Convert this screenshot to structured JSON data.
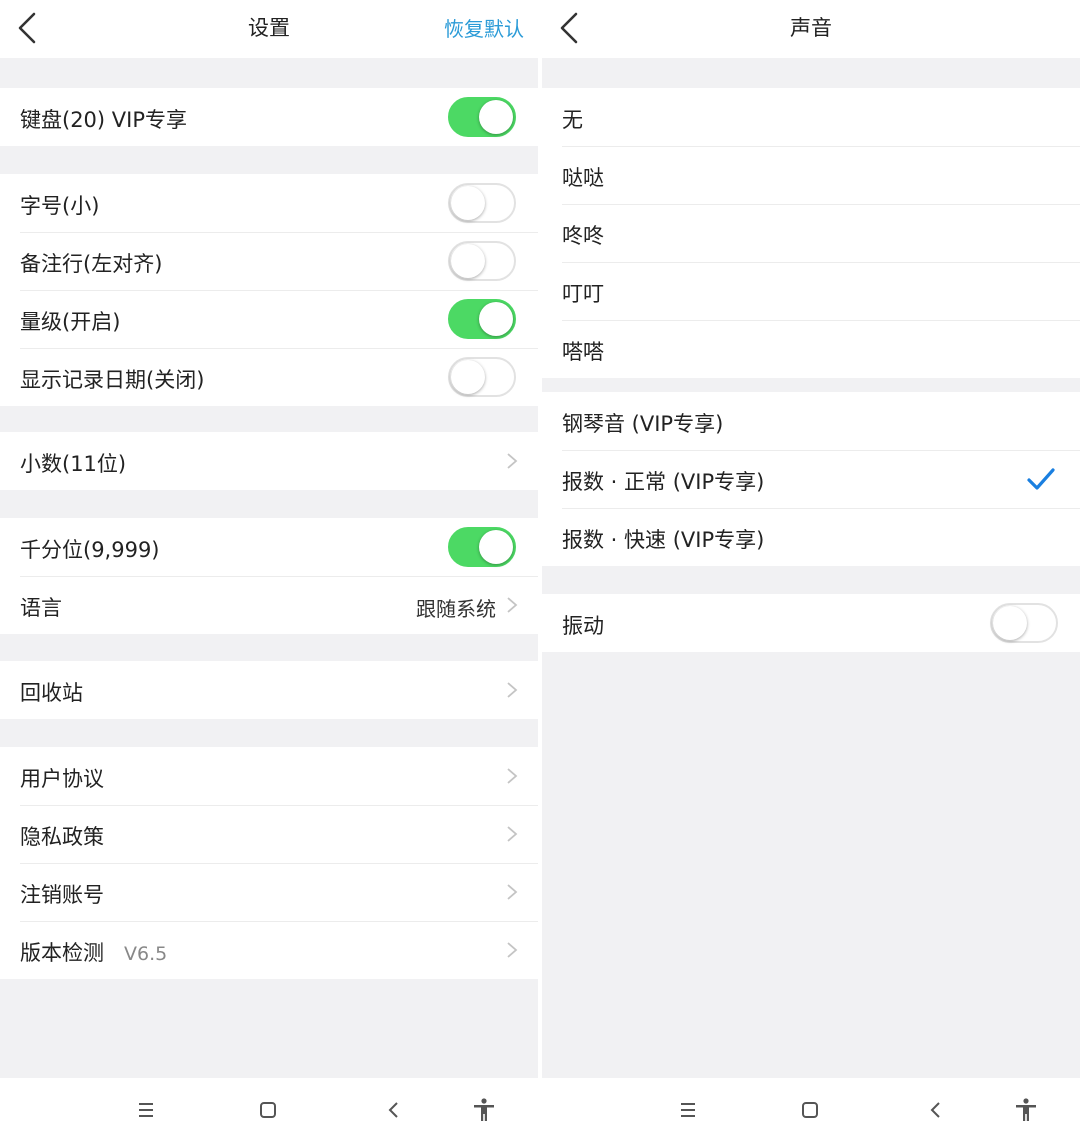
{
  "colors": {
    "accent": "#2b9bd7",
    "switch_on": "#4cd964",
    "check": "#1a7fe0",
    "background": "#f1f1f3"
  },
  "settings": {
    "back_icon": "chevron-left-icon",
    "title": "设置",
    "restore_label": "恢复默认",
    "keyboard": {
      "label": "键盘(20) VIP专享",
      "on": true
    },
    "font_size": {
      "label": "字号(小)",
      "on": false
    },
    "note_line": {
      "label": "备注行(左对齐)",
      "on": false
    },
    "magnitude": {
      "label": "量级(开启)",
      "on": true
    },
    "show_date": {
      "label": "显示记录日期(关闭)",
      "on": false
    },
    "decimals": {
      "label": "小数(11位)"
    },
    "thousands": {
      "label": "千分位(9,999)",
      "on": true
    },
    "language": {
      "label": "语言",
      "value": "跟随系统"
    },
    "recycle": {
      "label": "回收站"
    },
    "user_agreement": {
      "label": "用户协议"
    },
    "privacy": {
      "label": "隐私政策"
    },
    "delete_account": {
      "label": "注销账号"
    },
    "version_check": {
      "label": "版本检测",
      "version": "V6.5"
    }
  },
  "sound": {
    "back_icon": "chevron-left-icon",
    "title": "声音",
    "options_basic": [
      "无",
      "哒哒",
      "咚咚",
      "叮叮",
      "嗒嗒"
    ],
    "options_vip": [
      "钢琴音 (VIP专享)",
      "报数 · 正常 (VIP专享)",
      "报数 · 快速 (VIP专享)"
    ],
    "selected": "报数 · 正常 (VIP专享)",
    "vibration": {
      "label": "振动",
      "on": false
    }
  },
  "system_nav": {
    "icons": [
      "menu-icon",
      "home-icon",
      "back-icon",
      "accessibility-icon"
    ]
  }
}
